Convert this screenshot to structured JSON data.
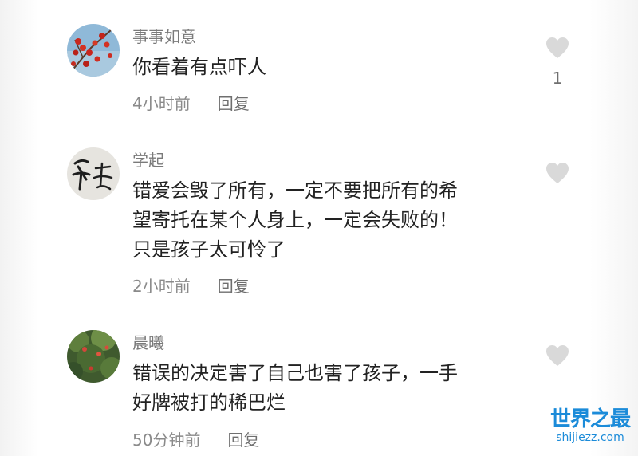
{
  "comments": [
    {
      "username": "事事如意",
      "text_lines": [
        "你看着有点吓人"
      ],
      "time": "4小时前",
      "reply_label": "回复",
      "like_count": "1"
    },
    {
      "username": "学起",
      "text_lines": [
        "错爱会毁了所有，一定不要把所有的希",
        "望寄托在某个人身上，一定会失败的！",
        "只是孩子太可怜了"
      ],
      "time": "2小时前",
      "reply_label": "回复",
      "like_count": ""
    },
    {
      "username": "晨曦",
      "text_lines": [
        "错误的决定害了自己也害了孩子，一手",
        "好牌被打的稀巴烂"
      ],
      "time": "50分钟前",
      "reply_label": "回复",
      "like_count": ""
    }
  ],
  "watermark": {
    "logo_text": "世界之最",
    "url": "shijiezz.com"
  },
  "colors": {
    "username": "#7a7a7a",
    "text": "#222222",
    "meta": "#8a8a8a",
    "heart": "#d9d9d9",
    "watermark": "#1b8bd9"
  }
}
